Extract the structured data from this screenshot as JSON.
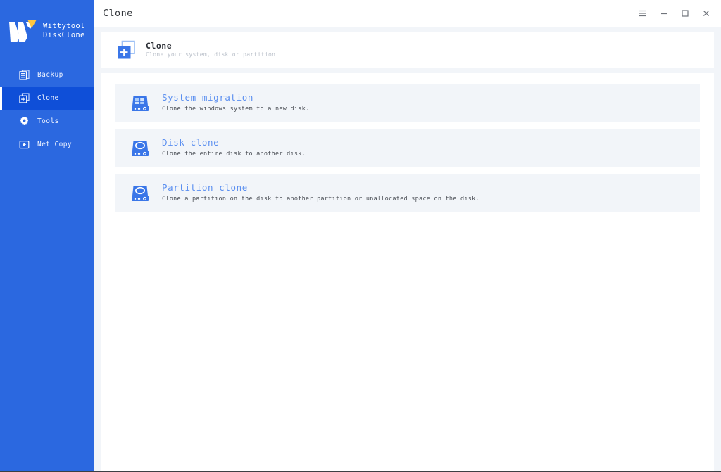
{
  "window": {
    "title": "Clone",
    "controls": [
      {
        "name": "menu-button",
        "icon": "hamburger-icon"
      },
      {
        "name": "minimize-button",
        "icon": "minimize-icon"
      },
      {
        "name": "maximize-button",
        "icon": "maximize-icon"
      },
      {
        "name": "close-button",
        "icon": "close-icon"
      }
    ]
  },
  "sidebar": {
    "brand": {
      "line1": "Wittytool",
      "line2": "DiskClone",
      "logo_icon": "w-logo-icon"
    },
    "items": [
      {
        "label": "Backup",
        "icon": "backup-icon",
        "active": false
      },
      {
        "label": "Clone",
        "icon": "clone-icon",
        "active": true
      },
      {
        "label": "Tools",
        "icon": "gear-icon",
        "active": false
      },
      {
        "label": "Net Copy",
        "icon": "net-copy-icon",
        "active": false
      }
    ]
  },
  "banner": {
    "icon": "clone-icon",
    "title": "Clone",
    "subtitle": "Clone your system, disk or partition"
  },
  "options": [
    {
      "icon": "windows-disk-icon",
      "title": "System migration",
      "subtitle": "Clone the windows system to a new disk."
    },
    {
      "icon": "disk-icon",
      "title": "Disk clone",
      "subtitle": "Clone the entire disk to another disk."
    },
    {
      "icon": "disk-icon",
      "title": "Partition clone",
      "subtitle": "Clone a partition on the disk to another partition or unallocated space on the disk."
    }
  ],
  "colors": {
    "sidebar_blue": "#2b68e0",
    "sidebar_active_blue": "#0f4fd8",
    "accent_blue": "#5b8ff0",
    "icon_blue": "#3a76e8",
    "logo_yellow": "#ffc640",
    "card_bg": "#f2f5f9",
    "panel_bg": "#ffffff"
  }
}
